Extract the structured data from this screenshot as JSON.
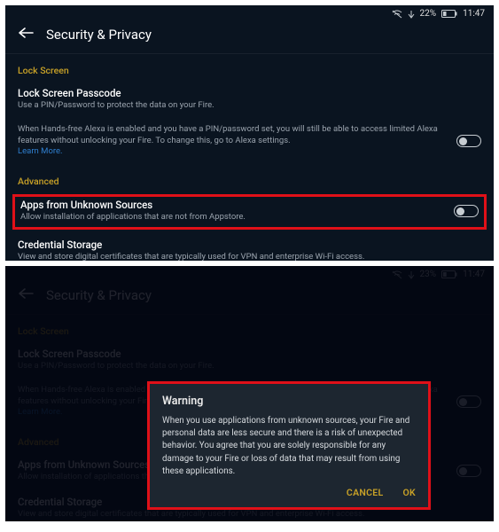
{
  "status1": {
    "battery": "22%",
    "time": "11:47"
  },
  "status2": {
    "battery": "23%",
    "time": "11:47"
  },
  "header": {
    "title": "Security & Privacy"
  },
  "sections": {
    "lockscreen": {
      "label": "Lock Screen",
      "passcode": {
        "title": "Lock Screen Passcode",
        "sub": "Use a PIN/Password to protect the data on your Fire."
      },
      "alexa": {
        "text": "When Hands-free Alexa is enabled and you have a PIN/password set, you will still be able to access limited Alexa features without unlocking your Fire. To change this, go to Alexa settings.",
        "learn": "Learn More."
      }
    },
    "advanced": {
      "label": "Advanced",
      "unknown": {
        "title": "Apps from Unknown Sources",
        "sub": "Allow installation of applications that are not from Appstore."
      },
      "cred": {
        "title": "Credential Storage",
        "sub": "View and store digital certificates that are typically used for VPN and enterprise Wi-Fi access."
      }
    }
  },
  "dialog": {
    "title": "Warning",
    "body": "When you use applications from unknown sources, your Fire and personal data are less secure and there is a risk of unexpected behavior. You agree that you are solely responsible for any damage to your Fire or loss of data that may result from using these applications.",
    "cancel": "CANCEL",
    "ok": "OK"
  }
}
